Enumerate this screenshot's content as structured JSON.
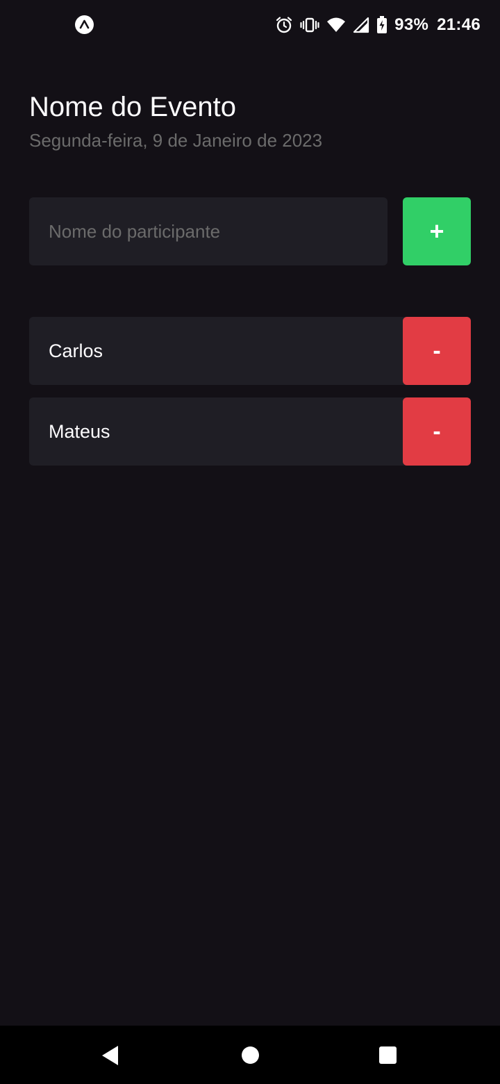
{
  "status_bar": {
    "battery": "93%",
    "time": "21:46",
    "icons": [
      "expo-icon",
      "alarm-icon",
      "vibrate-icon",
      "wifi-icon",
      "signal-icon",
      "battery-charging-icon"
    ]
  },
  "header": {
    "title": "Nome do Evento",
    "date": "Segunda-feira, 9 de Janeiro de 2023"
  },
  "form": {
    "input_value": "",
    "input_placeholder": "Nome do participante",
    "add_label": "+"
  },
  "participants": [
    {
      "name": "Carlos",
      "remove_label": "-"
    },
    {
      "name": "Mateus",
      "remove_label": "-"
    }
  ],
  "nav_bar": {
    "icons": [
      "back-icon",
      "home-icon",
      "recents-icon"
    ]
  },
  "colors": {
    "background": "#131016",
    "surface": "#1F1E25",
    "text": "#FDFCFE",
    "muted_text": "#6B6B6B",
    "add_button": "#31CF67",
    "remove_button": "#E23C44"
  }
}
